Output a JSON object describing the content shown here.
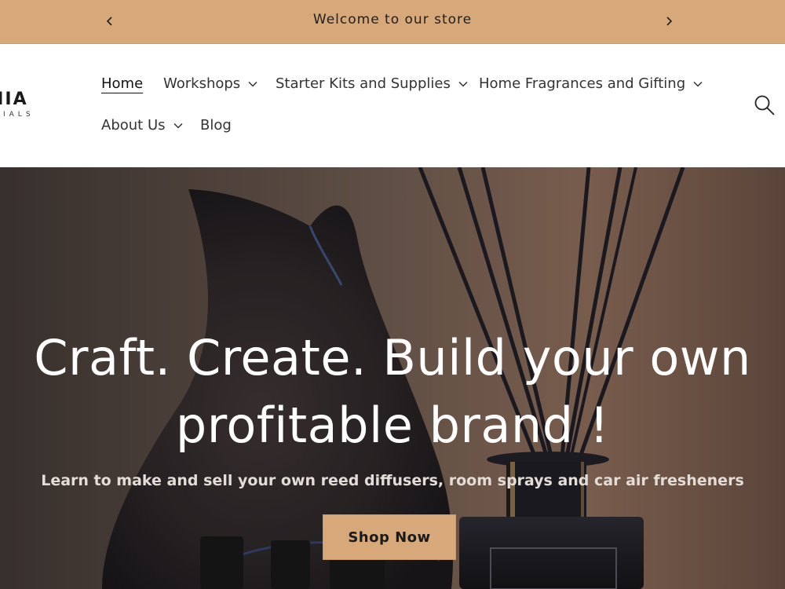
{
  "announcement": {
    "message": "Welcome to our store",
    "prev_icon": "chevron-left-icon",
    "next_icon": "chevron-right-icon"
  },
  "logo": {
    "line1": "NIA",
    "line2": "IALS"
  },
  "nav": {
    "items": [
      {
        "label": "Home",
        "active": true,
        "dropdown": false
      },
      {
        "label": "Workshops",
        "active": false,
        "dropdown": true
      },
      {
        "label": "Starter Kits and Supplies",
        "active": false,
        "dropdown": true
      },
      {
        "label": "Home Fragrances and Gifting",
        "active": false,
        "dropdown": true
      },
      {
        "label": "About Us",
        "active": false,
        "dropdown": true
      },
      {
        "label": "Blog",
        "active": false,
        "dropdown": false
      }
    ],
    "search_icon": "search-icon"
  },
  "hero": {
    "title_line1": "Craft. Create. Build your own",
    "title_line2": "profitable brand !",
    "subtitle": "Learn to make and sell your own reed diffusers, room sprays and car air fresheners",
    "cta_label": "Shop Now"
  },
  "colors": {
    "accent": "#d7a97a",
    "text_dark": "#1f1f1f",
    "hero_text": "#ffffff"
  }
}
